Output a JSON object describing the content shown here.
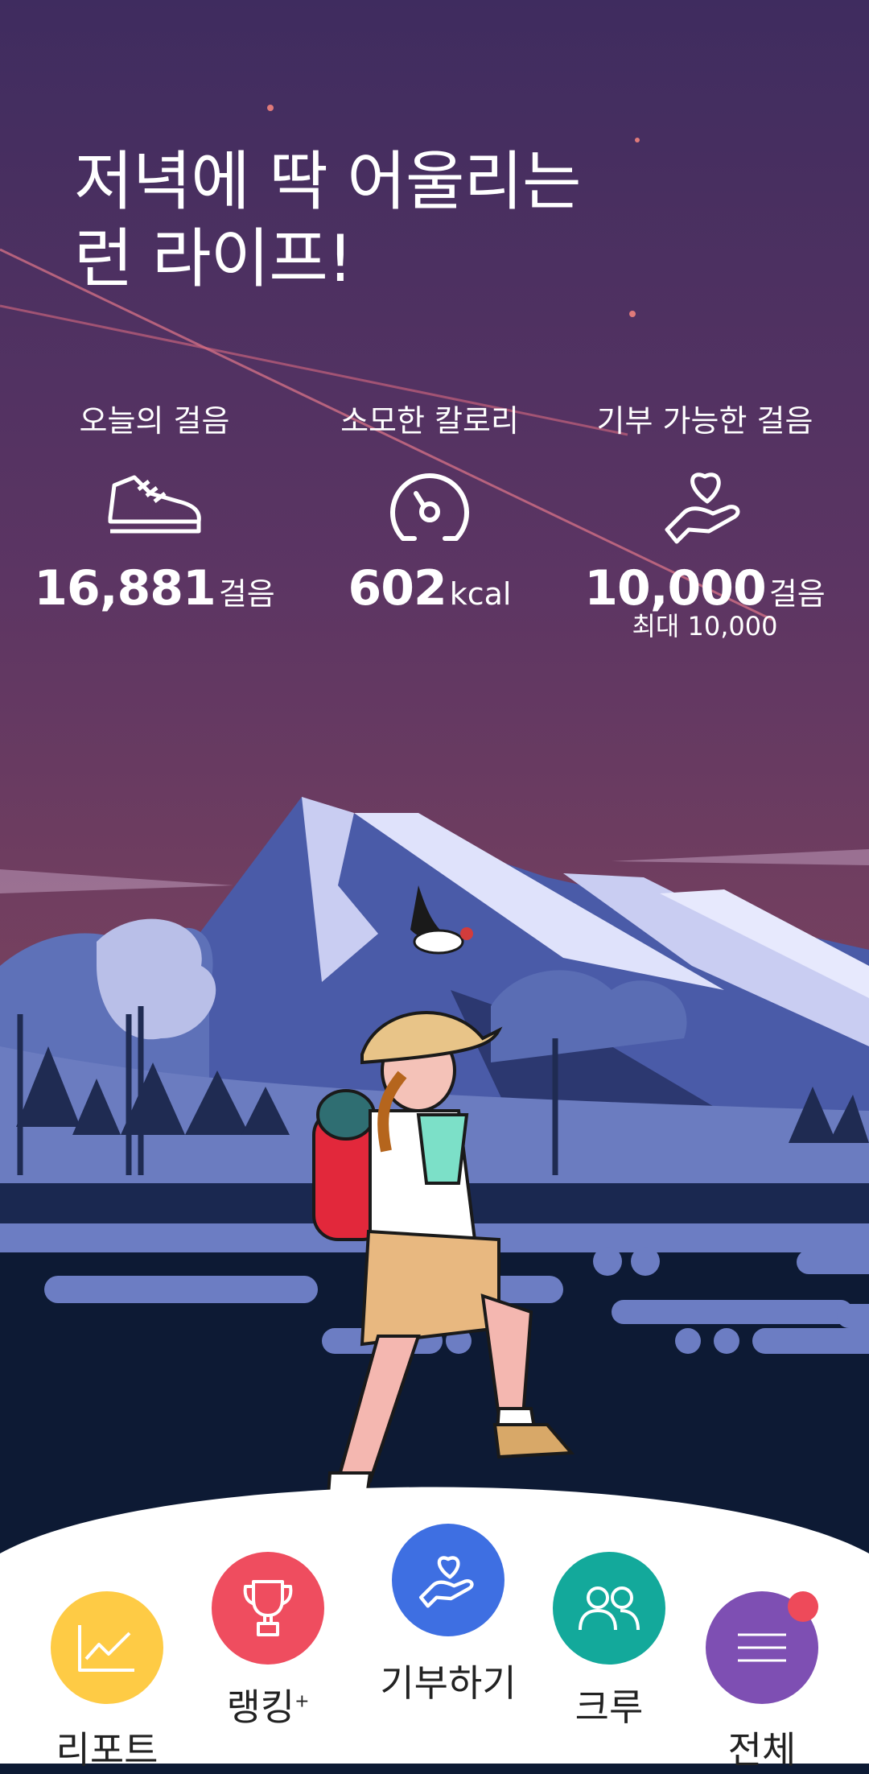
{
  "headline": {
    "line1": "저녁에 딱 어울리는",
    "line2": "런 라이프!"
  },
  "stats": [
    {
      "label": "오늘의 걸음",
      "value": "16,881",
      "unit": "걸음",
      "icon": "sneaker-icon"
    },
    {
      "label": "소모한 칼로리",
      "value": "602",
      "unit": "kcal",
      "icon": "gauge-icon"
    },
    {
      "label": "기부 가능한 걸음",
      "value": "10,000",
      "unit": "걸음",
      "sub": "최대 10,000",
      "icon": "heart-hand-icon"
    }
  ],
  "nav": {
    "report": {
      "label": "리포트",
      "color": "#fecb45",
      "icon": "chart-icon"
    },
    "ranking": {
      "label": "랭킹",
      "sup": "+",
      "color": "#ef4d5f",
      "icon": "trophy-icon"
    },
    "donate": {
      "label": "기부하기",
      "color": "#3e6fe2",
      "icon": "heart-hand-icon"
    },
    "crew": {
      "label": "크루",
      "color": "#13a99b",
      "icon": "people-icon"
    },
    "all": {
      "label": "전체",
      "color": "#7e4fb3",
      "icon": "menu-icon"
    }
  },
  "colors": {
    "sky_top": "#3f2c5f",
    "sky_bottom": "#6c3a62",
    "mountain": "#4a5ba8",
    "ground": "#0d1a34"
  }
}
